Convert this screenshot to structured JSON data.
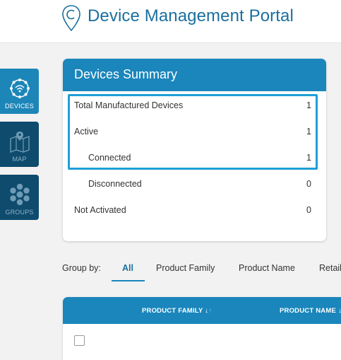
{
  "header": {
    "title": "Device Management Portal"
  },
  "rail": {
    "devices_label": "DEVICES",
    "map_label": "MAP",
    "groups_label": "GROUPS"
  },
  "summary": {
    "title": "Devices Summary",
    "rows": [
      {
        "label": "Total Manufactured Devices",
        "value": "1"
      },
      {
        "label": "Active",
        "value": "1"
      },
      {
        "label": "Connected",
        "value": "1"
      },
      {
        "label": "Disconnected",
        "value": "0"
      },
      {
        "label": "Not Activated",
        "value": "0"
      }
    ]
  },
  "groupby": {
    "label": "Group by:",
    "tabs": [
      "All",
      "Product Family",
      "Product Name",
      "Retail"
    ],
    "active": "All"
  },
  "table": {
    "columns": [
      {
        "label": "PRODUCT FAMILY",
        "sort": "↓",
        "sort_alt": "↑"
      },
      {
        "label": "PRODUCT NAME",
        "sort": "↓"
      }
    ]
  },
  "colors": {
    "accent": "#1a86bb",
    "rail_dark": "#0e4b6d",
    "highlight": "#1f9fd8"
  }
}
